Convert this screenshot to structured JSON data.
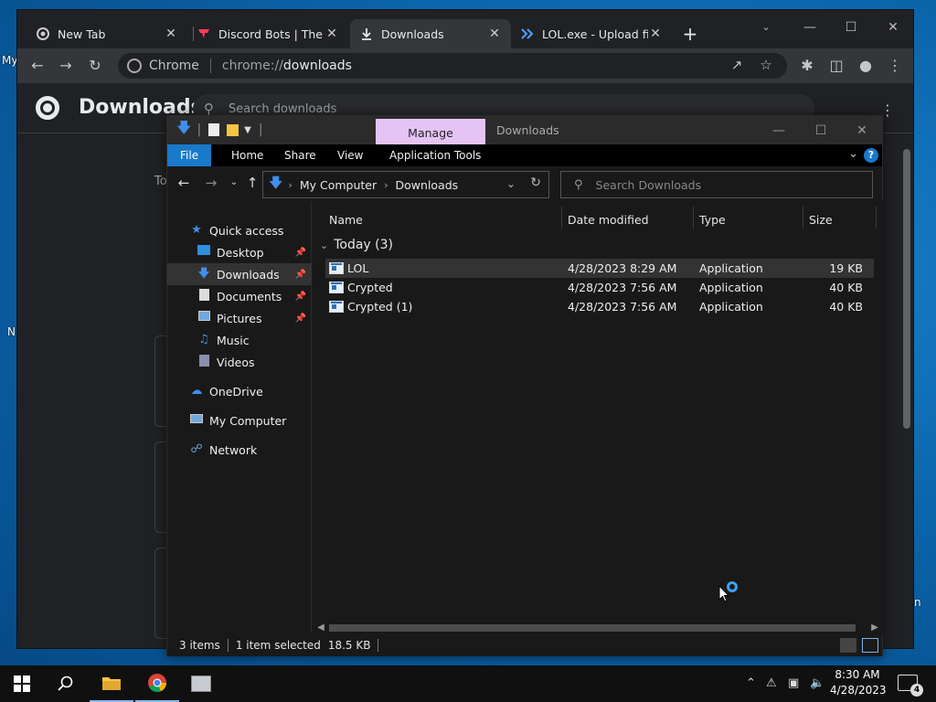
{
  "desktop": {
    "frag_my": "My",
    "frag_n": "N",
    "frag_n2": "n"
  },
  "chrome": {
    "tabs": [
      {
        "label": "New Tab",
        "icon": "chrome-icon"
      },
      {
        "label": "Discord Bots | The #",
        "icon": "discord-bots-icon"
      },
      {
        "label": "Downloads",
        "icon": "download-icon"
      },
      {
        "label": "LOL.exe - Upload file",
        "icon": "upload-icon"
      }
    ],
    "close_glyph": "✕",
    "new_tab_glyph": "+",
    "omnibox": {
      "site": "Chrome",
      "url_scheme": "chrome://",
      "url_host": "downloads"
    },
    "page": {
      "title": "Downloads",
      "search_placeholder": "Search downloads",
      "to_fragment": "To"
    }
  },
  "explorer": {
    "manage_tab": "Manage",
    "window_title": "Downloads",
    "ribbon_tabs": [
      "File",
      "Home",
      "Share",
      "View",
      "Application Tools"
    ],
    "help_glyph": "?",
    "address": {
      "parts": [
        "My Computer",
        "Downloads"
      ]
    },
    "search_placeholder": "Search Downloads",
    "nav": [
      {
        "label": "Quick access"
      },
      {
        "label": "Desktop"
      },
      {
        "label": "Downloads"
      },
      {
        "label": "Documents"
      },
      {
        "label": "Pictures"
      },
      {
        "label": "Music"
      },
      {
        "label": "Videos"
      },
      {
        "label": "OneDrive"
      },
      {
        "label": "My Computer"
      },
      {
        "label": "Network"
      }
    ],
    "columns": {
      "name": "Name",
      "date": "Date modified",
      "type": "Type",
      "size": "Size"
    },
    "group": {
      "label": "Today (3)"
    },
    "files": [
      {
        "name": "LOL",
        "date": "4/28/2023 8:29 AM",
        "type": "Application",
        "size": "19 KB"
      },
      {
        "name": "Crypted",
        "date": "4/28/2023 7:56 AM",
        "type": "Application",
        "size": "40 KB"
      },
      {
        "name": "Crypted (1)",
        "date": "4/28/2023 7:56 AM",
        "type": "Application",
        "size": "40 KB"
      }
    ],
    "status": {
      "count": "3 items",
      "selection": "1 item selected",
      "size": "18.5 KB"
    }
  },
  "taskbar": {
    "time": "8:30 AM",
    "date": "4/28/2023",
    "notifications": "4"
  },
  "colors": {
    "accent": "#1979ca",
    "manage_tab": "#e6c3f5",
    "desktop": "#0b63a8"
  }
}
